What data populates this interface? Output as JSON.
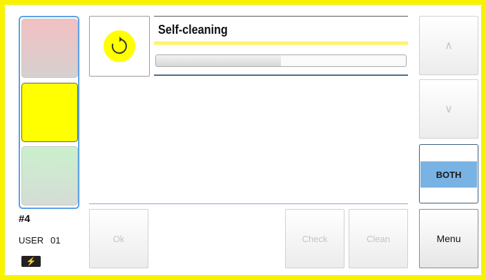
{
  "program": {
    "title": "Self-cleaning",
    "icon": "refresh-icon",
    "progress_fraction": 0.5
  },
  "status": {
    "station": "#4",
    "user_label": "USER",
    "user_number": "01",
    "power_icon": "power-icon"
  },
  "lights": {
    "active": "yellow"
  },
  "buttons": {
    "ok": "Ok",
    "check": "Check",
    "clean": "Clean",
    "up": "∧",
    "down": "∨",
    "both": "BOTH",
    "menu": "Menu"
  },
  "colors": {
    "frame": "#f7f200",
    "active_light": "#ffff00",
    "selected": "#79b3e4"
  }
}
